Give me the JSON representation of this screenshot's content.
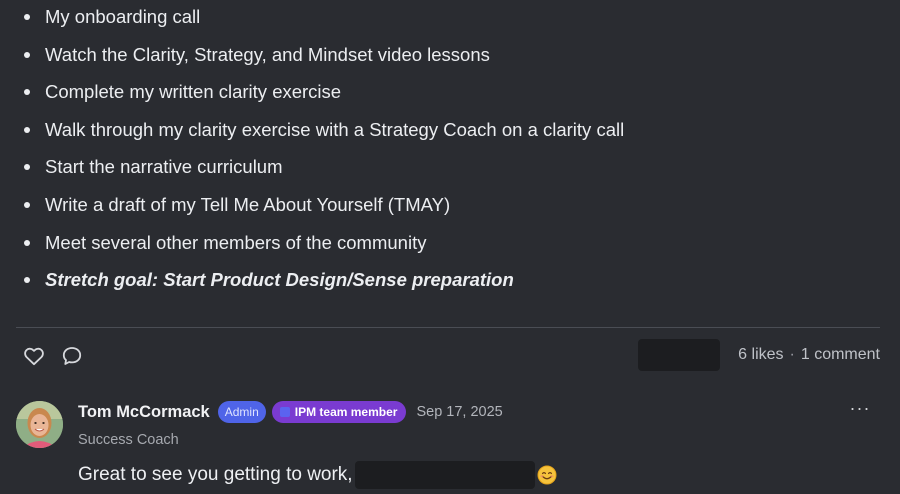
{
  "checklist": [
    {
      "text": "My onboarding call"
    },
    {
      "text": "Watch the Clarity, Strategy, and Mindset video lessons"
    },
    {
      "text": "Complete my written clarity exercise"
    },
    {
      "text": "Walk through my clarity exercise with a Strategy Coach on a clarity call"
    },
    {
      "text": "Start the narrative curriculum"
    },
    {
      "text": "Write a draft of my Tell Me About Yourself (TMAY)"
    },
    {
      "text": "Meet several other members of the community"
    },
    {
      "text": "Stretch goal: Start Product Design/Sense preparation"
    }
  ],
  "actions": {
    "like_icon": "heart-icon",
    "comment_icon": "speech-bubble-icon",
    "likes": "6 likes",
    "separator": "·",
    "comments": "1 comment"
  },
  "comment": {
    "author": "Tom McCormack",
    "badges": {
      "admin": "Admin",
      "team": "IPM team member"
    },
    "timestamp": "Sep 17, 2025",
    "role": "Success Coach",
    "body_prefix": "Great to see you getting to work,",
    "emoji": "smiling-face-emoji",
    "more_icon": "ellipsis-icon",
    "more_glyph": "···"
  },
  "colors": {
    "background": "#2a2c31",
    "admin_badge": "#4f64e8",
    "team_badge": "#7a3bd1",
    "redaction": "#1c1d20"
  }
}
